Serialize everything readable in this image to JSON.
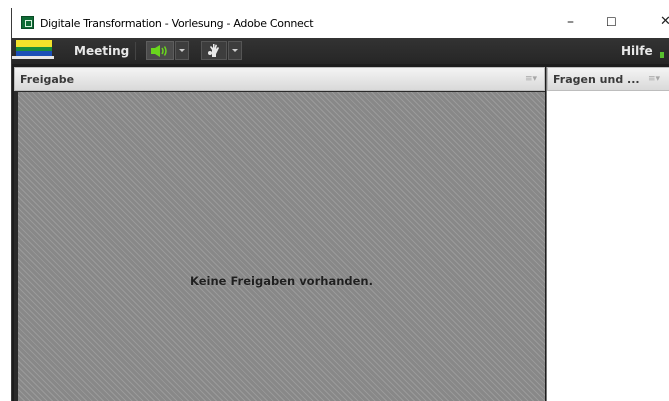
{
  "window": {
    "title": "Digitale Transformation - Vorlesung - Adobe Connect",
    "minimize": "–",
    "maximize": "☐",
    "close": "✕"
  },
  "menubar": {
    "meeting_label": "Meeting",
    "help_label": "Hilfe"
  },
  "share_pod": {
    "title": "Freigabe",
    "menu_glyph": "≡▾",
    "empty_message": "Keine Freigaben vorhanden."
  },
  "qa_pod": {
    "title": "Fragen und ...",
    "menu_glyph": "≡▾"
  },
  "colors": {
    "audio_active": "#6ad61d",
    "brand_green": "#0f6b35"
  },
  "icons": {
    "app": "adobe-connect-icon",
    "audio": "speaker-icon",
    "status": "raise-hand-icon",
    "connection": "connection-signal-icon"
  }
}
